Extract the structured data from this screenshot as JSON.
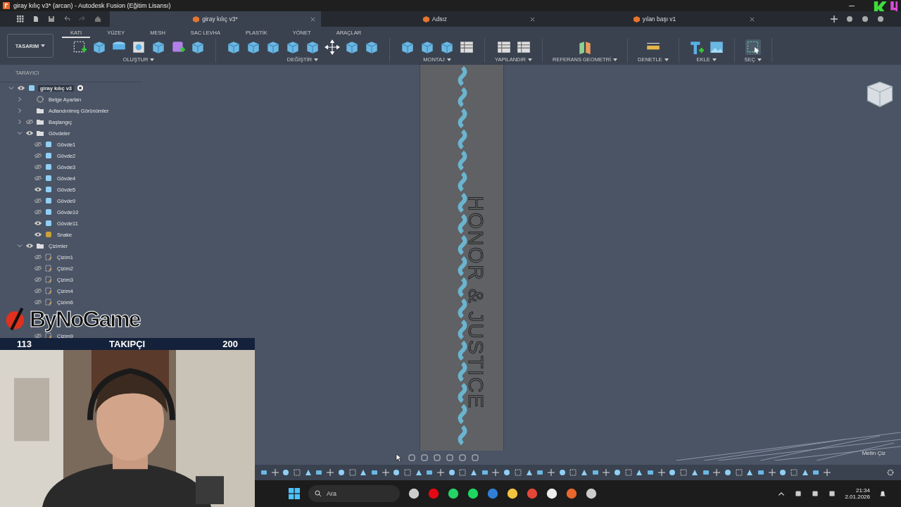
{
  "window": {
    "title": "giray kılıç v3* (arcan) - Autodesk Fusion (Eğitim Lisansı)"
  },
  "document_tabs": [
    {
      "label": "giray kılıç v3*",
      "selected": true
    },
    {
      "label": "Adsız",
      "selected": false
    },
    {
      "label": "yılan başı v1",
      "selected": false
    }
  ],
  "workspace": {
    "label": "TASARIM"
  },
  "ribbon_tabs": [
    {
      "label": "KATI",
      "selected": true
    },
    {
      "label": "YÜZEY",
      "selected": false
    },
    {
      "label": "MESH",
      "selected": false
    },
    {
      "label": "SAC LEVHA",
      "selected": false
    },
    {
      "label": "PLASTİK",
      "selected": false
    },
    {
      "label": "YÖNET",
      "selected": false
    },
    {
      "label": "ARAÇLAR",
      "selected": false
    }
  ],
  "tool_groups": [
    {
      "label": "OLUŞTUR"
    },
    {
      "label": "DEĞİŞTİR"
    },
    {
      "label": "MONTAJ"
    },
    {
      "label": "YAPILANDIR"
    },
    {
      "label": "REFERANS GEOMETRİ"
    },
    {
      "label": "DENETLE"
    },
    {
      "label": "EKLE"
    },
    {
      "label": "SEÇ"
    }
  ],
  "browser": {
    "title": "TARAYICI",
    "tree": [
      {
        "label": "giray kılıç v3",
        "kind": "component",
        "visible": true,
        "expanded": true,
        "selected": true,
        "children": [
          {
            "label": "Belge Ayarları",
            "kind": "settings",
            "expanded": false,
            "selected": false
          },
          {
            "label": "Adlandırılmış Görünümler",
            "kind": "folder",
            "expanded": false,
            "selected": false
          },
          {
            "label": "Başlangıç",
            "kind": "folder",
            "visible": false,
            "expanded": false,
            "selected": false
          },
          {
            "label": "Gövdeler",
            "kind": "folder",
            "visible": true,
            "expanded": true,
            "selected": false,
            "children": [
              {
                "label": "Gövde1",
                "kind": "body",
                "visible": false,
                "selected": false
              },
              {
                "label": "Gövde2",
                "kind": "body",
                "visible": false,
                "selected": false
              },
              {
                "label": "Gövde3",
                "kind": "body",
                "visible": false,
                "selected": false
              },
              {
                "label": "Gövde4",
                "kind": "body",
                "visible": false,
                "selected": false
              },
              {
                "label": "Gövde5",
                "kind": "body",
                "visible": true,
                "selected": false
              },
              {
                "label": "Gövde9",
                "kind": "body",
                "visible": false,
                "selected": false
              },
              {
                "label": "Gövde10",
                "kind": "body",
                "visible": false,
                "selected": false
              },
              {
                "label": "Gövde11",
                "kind": "body",
                "visible": true,
                "selected": false
              },
              {
                "label": "Snake",
                "kind": "mesh",
                "visible": true,
                "selected": false
              }
            ]
          },
          {
            "label": "Çizimler",
            "kind": "folder",
            "visible": true,
            "expanded": true,
            "selected": false,
            "children": [
              {
                "label": "Çizim1",
                "kind": "sketch",
                "visible": false,
                "selected": false
              },
              {
                "label": "Çizim2",
                "kind": "sketch",
                "visible": false,
                "selected": false
              },
              {
                "label": "Çizim3",
                "kind": "sketch",
                "visible": false,
                "selected": false
              },
              {
                "label": "Çizim4",
                "kind": "sketch",
                "visible": false,
                "selected": false
              },
              {
                "label": "Çizim6",
                "kind": "sketch",
                "visible": false,
                "selected": false
              },
              {
                "label": "Çizim9",
                "kind": "sketch",
                "visible": false,
                "selected": false
              }
            ]
          }
        ]
      }
    ]
  },
  "viewport": {
    "model_text": "HONOR & JUSTICE",
    "command_hint": "Metin Çiz"
  },
  "overlay": {
    "logo": "ByNoGame",
    "follower_bar": {
      "current": "113",
      "label": "TAKIPÇI",
      "goal": "200"
    }
  },
  "taskbar": {
    "search_placeholder": "Ara",
    "time": "21:34",
    "date": "2.01.2026"
  }
}
